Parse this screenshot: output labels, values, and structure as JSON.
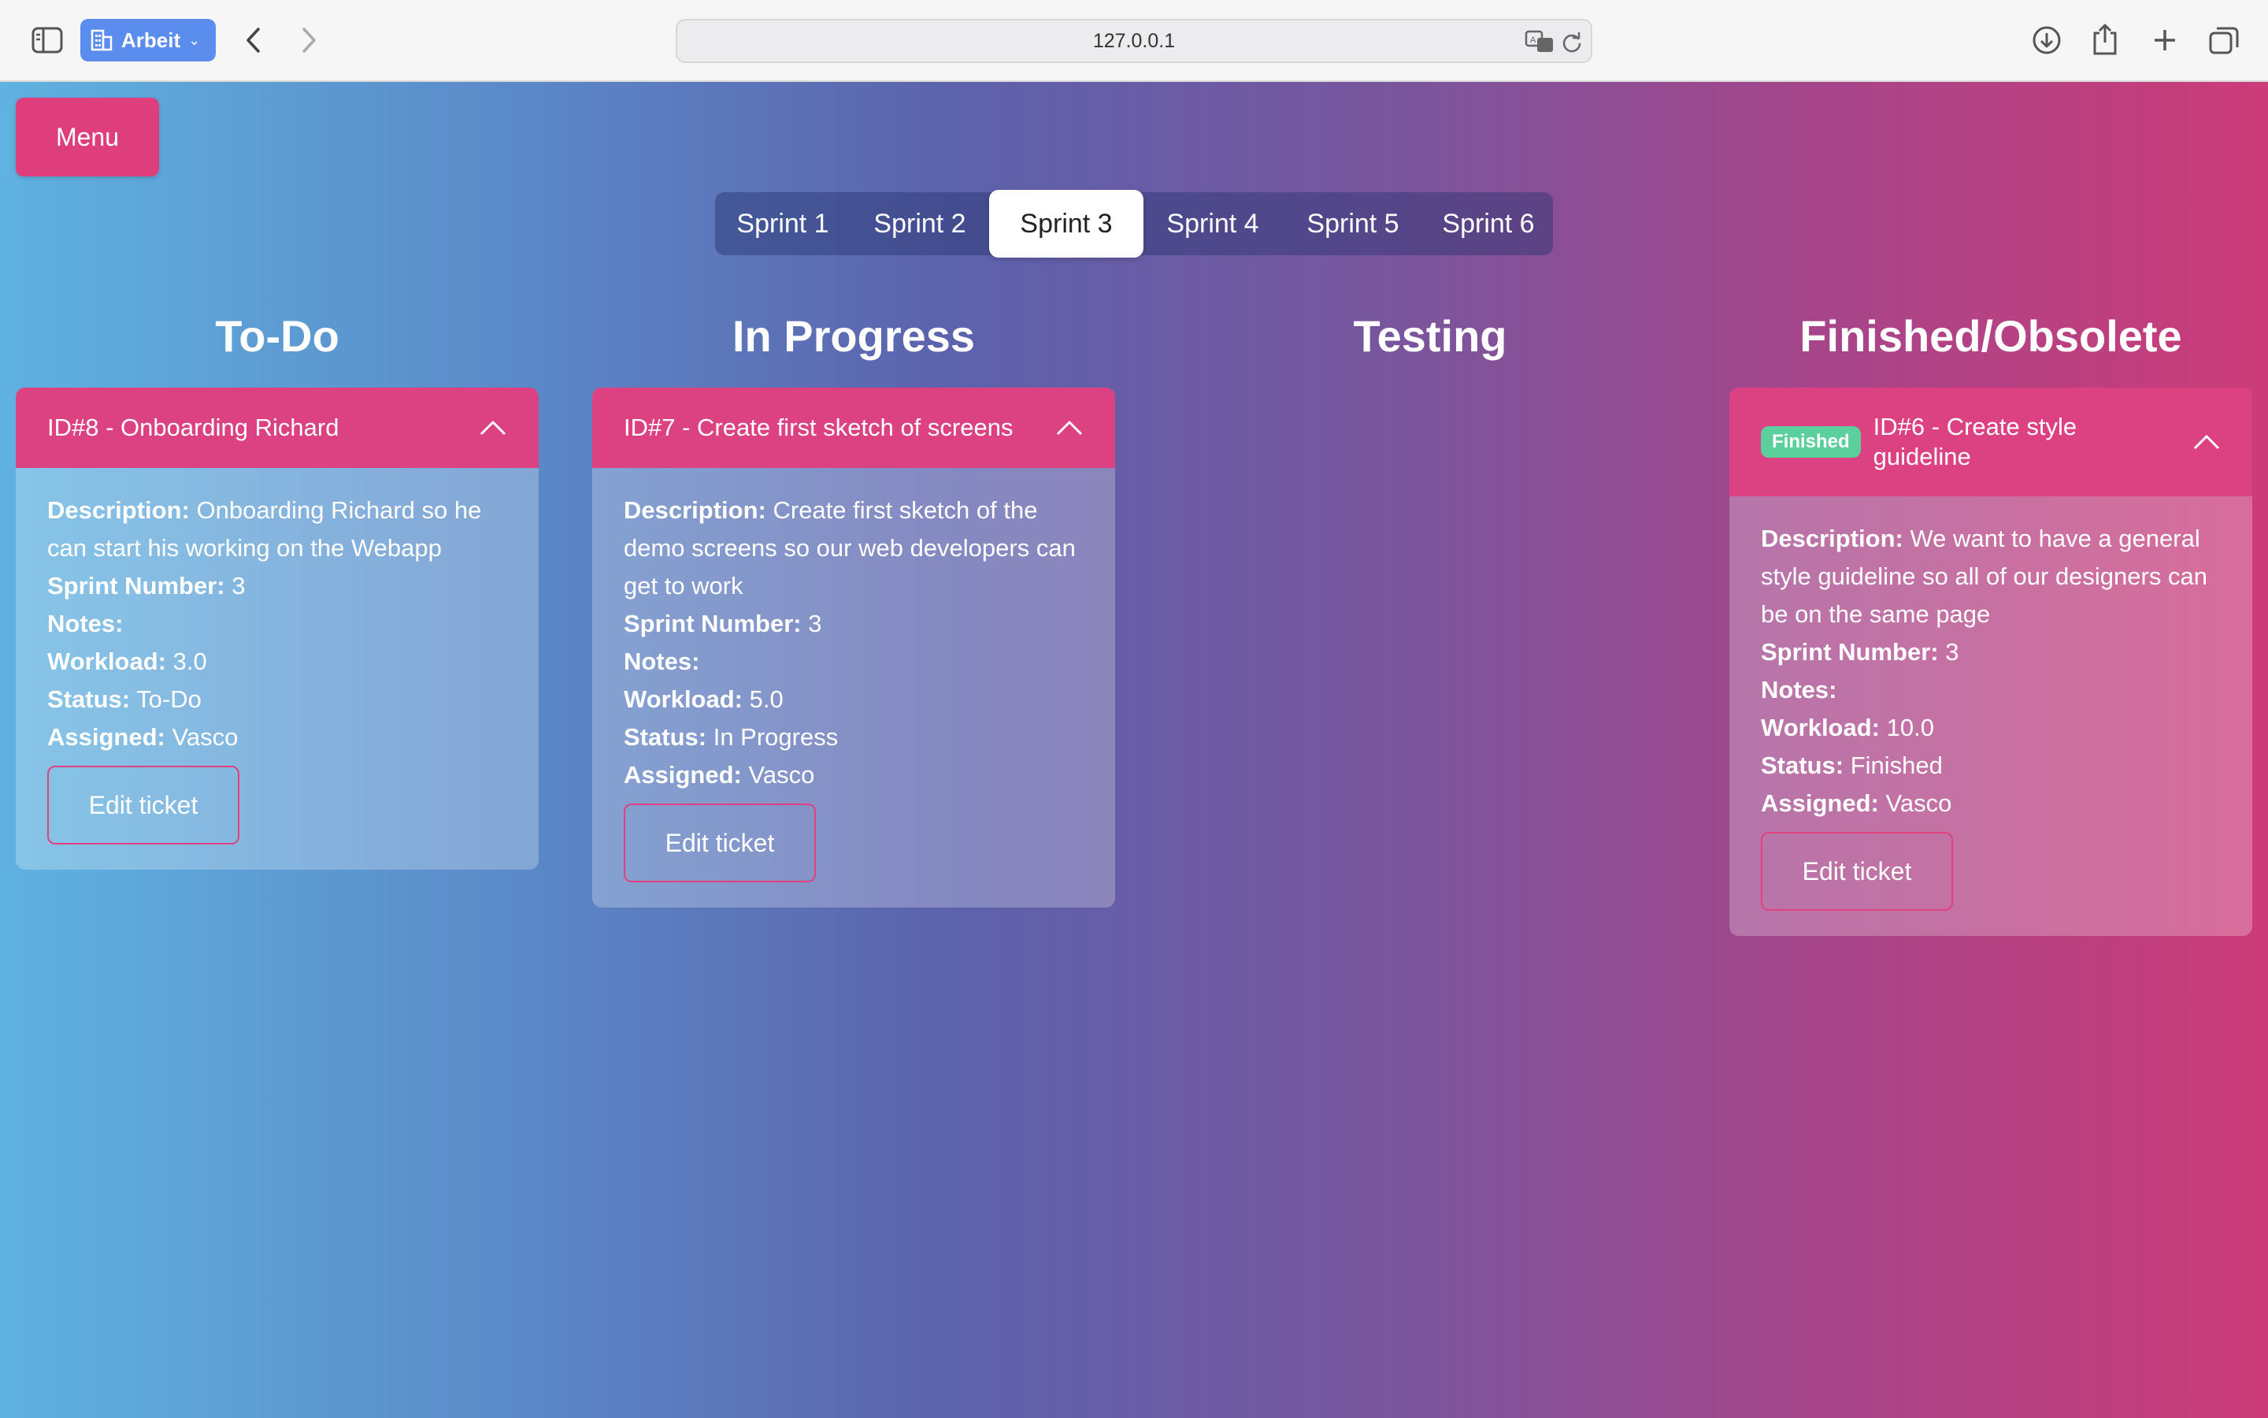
{
  "browser": {
    "profile_label": "Arbeit",
    "url": "127.0.0.1"
  },
  "menu": {
    "label": "Menu"
  },
  "sprints": {
    "tabs": [
      "Sprint 1",
      "Sprint 2",
      "Sprint 3",
      "Sprint 4",
      "Sprint 5",
      "Sprint 6"
    ],
    "active": "Sprint 3"
  },
  "columns": {
    "todo": "To-Do",
    "in_progress": "In Progress",
    "testing": "Testing",
    "finished": "Finished/Obsolete"
  },
  "field_labels": {
    "description": "Description:",
    "sprint_number": "Sprint Number:",
    "notes": "Notes:",
    "workload": "Workload:",
    "status": "Status:",
    "assigned": "Assigned:"
  },
  "tickets": {
    "t8": {
      "title": "ID#8 - Onboarding Richard",
      "description": "Onboarding Richard so he can start his working on the Webapp",
      "sprint_number": "3",
      "notes": "",
      "workload": "3.0",
      "status": "To-Do",
      "assigned": "Vasco",
      "edit_label": "Edit ticket"
    },
    "t7": {
      "title": "ID#7 - Create first sketch of screens",
      "description": "Create first sketch of the demo screens so our web developers can get to work",
      "sprint_number": "3",
      "notes": "",
      "workload": "5.0",
      "status": "In Progress",
      "assigned": "Vasco",
      "edit_label": "Edit ticket"
    },
    "t6": {
      "badge": "Finished",
      "title": "ID#6 - Create style guideline",
      "description": "We want to have a general style guideline so all of our designers can be on the same page",
      "sprint_number": "3",
      "notes": "",
      "workload": "10.0",
      "status": "Finished",
      "assigned": "Vasco",
      "edit_label": "Edit ticket"
    }
  },
  "colors": {
    "accent": "#dc4281",
    "badge_green": "#5bcf9c",
    "profile_blue": "#5b8def"
  }
}
